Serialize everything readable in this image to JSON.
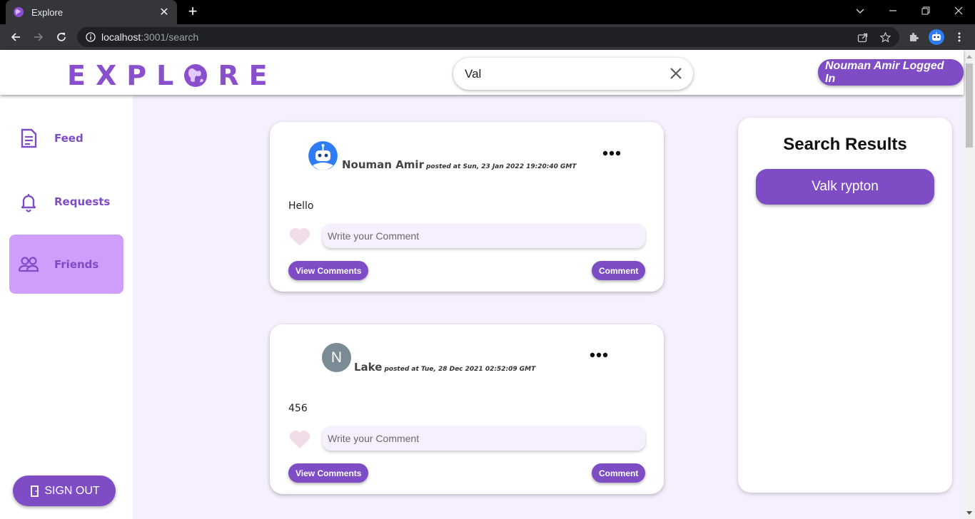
{
  "browser": {
    "tab_title": "Explore",
    "url_host": "localhost",
    "url_path": ":3001/search"
  },
  "header": {
    "logo_left": "EXPL",
    "logo_right": "RE",
    "search_value": "Val",
    "logged_in_label": "Nouman Amir Logged In"
  },
  "sidebar": {
    "items": [
      {
        "label": "Feed",
        "icon": "document-icon",
        "active": false
      },
      {
        "label": "Requests",
        "icon": "bell-icon",
        "active": false
      },
      {
        "label": "Friends",
        "icon": "people-icon",
        "active": true
      }
    ],
    "signout_label": "SIGN OUT"
  },
  "posts": [
    {
      "author": "Nouman Amir",
      "posted_at": "posted at Sun, 23 Jan 2022 19:20:40 GMT",
      "avatar": "robot-avatar",
      "body": "Hello",
      "comment_placeholder": "Write your Comment",
      "view_comments_label": "View Comments",
      "comment_label": "Comment"
    },
    {
      "author": "Lake",
      "posted_at": "posted at Tue, 28 Dec 2021 02:52:09 GMT",
      "avatar_letter": "N",
      "body": "456",
      "comment_placeholder": "Write your Comment",
      "view_comments_label": "View Comments",
      "comment_label": "Comment"
    }
  ],
  "search_results": {
    "title": "Search Results",
    "items": [
      "Valk rypton"
    ]
  },
  "colors": {
    "brand": "#7e4cc4",
    "active_nav": "#cf9dfb",
    "page_bg": "#f6effd"
  }
}
